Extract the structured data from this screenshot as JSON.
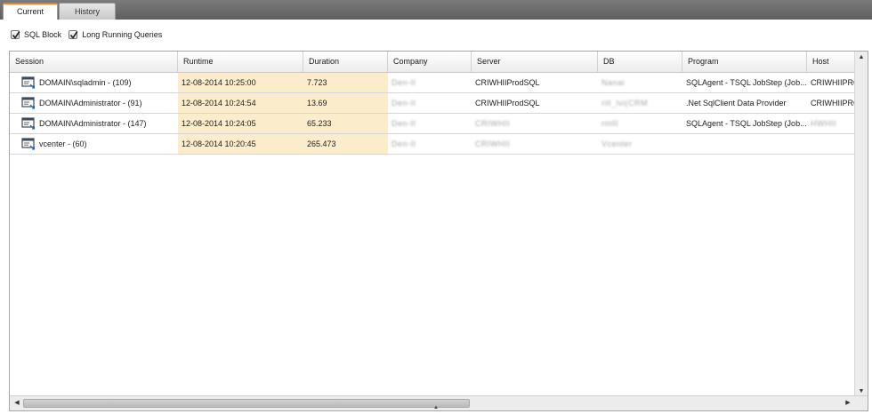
{
  "tabs": [
    {
      "label": "Current",
      "active": true
    },
    {
      "label": "History",
      "active": false
    }
  ],
  "filters": {
    "sql_block": {
      "label": "SQL Block",
      "checked": true
    },
    "long_running": {
      "label": "Long Running Queries",
      "checked": true
    }
  },
  "grid": {
    "columns": [
      "Session",
      "Runtime",
      "Duration",
      "Company",
      "Server",
      "DB",
      "Program",
      "Host"
    ],
    "rows": [
      {
        "session": "DOMAIN\\sqladmin - (109)",
        "runtime": "12-08-2014 10:25:00",
        "duration": "7.723",
        "company": "Den-II",
        "server": "CRIWHIIProdSQL",
        "db": "Nanai",
        "program": "SQLAgent - TSQL JobStep (Job...",
        "host": "CRIWHIIPRO"
      },
      {
        "session": "DOMAIN\\Administrator - (91)",
        "runtime": "12-08-2014 10:24:54",
        "duration": "13.69",
        "company": "Den-II",
        "server": "CRIWHIIProdSQL",
        "db": "rill_lvi(CRM",
        "program": ".Net SqlClient Data Provider",
        "host": "CRIWHIIPRO"
      },
      {
        "session": "DOMAIN\\Administrator - (147)",
        "runtime": "12-08-2014 10:24:05",
        "duration": "65.233",
        "company": "Den-II",
        "server": "CRIWHII",
        "db": "rmlll",
        "program": "SQLAgent - TSQL JobStep (Job...",
        "host": "HWHII"
      },
      {
        "session": "vcenter - (60)",
        "runtime": "12-08-2014 10:20:45",
        "duration": "265.473",
        "company": "Den-II",
        "server": "CRIWHII",
        "db": "Vcenter",
        "program": "",
        "host": ""
      }
    ]
  },
  "colors": {
    "accent": "#f07c2a",
    "highlight": "#fbeccb"
  },
  "icons": {
    "session": "session-window-icon",
    "checkbox": "checkmark-icon"
  }
}
